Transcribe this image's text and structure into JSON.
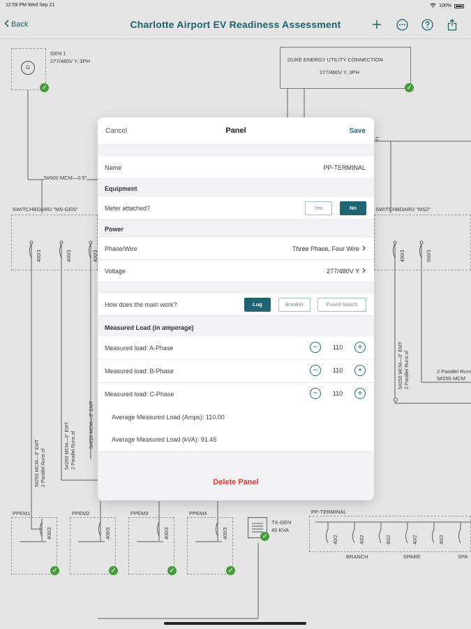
{
  "status_bar": {
    "time": "12:59 PM  Wed Sep 21",
    "battery": "100%"
  },
  "nav": {
    "back_label": "Back",
    "title": "Charlotte Airport EV Readiness Assessment"
  },
  "diagram": {
    "gen": {
      "name": "GEN 1",
      "spec": "277/480V Y, 3PH"
    },
    "utility": {
      "name": "DUKE ENERGY UTILITY CONNECTION",
      "spec": "277/480V Y, 3PH"
    },
    "feed_label": "5#500 MCM—0.5\"",
    "edge_label": "C",
    "swbd_gen": "SWITCHBOARD \"MS-GEN\"",
    "swbd_ms2": "SWITCHBOARD \"MS2\"",
    "left_breakers": [
      "400/3",
      "400/3",
      "400/3"
    ],
    "right_breakers": [
      "400/3",
      "500/3"
    ],
    "cable_a": "5#250 MCM—3\" EMT",
    "cable_a2": "2 Parallel Runs of",
    "cable_b": "5#250 MCM—3\" EMT",
    "cable_b2": "2 Parallel Runs of",
    "cable_c": "5#250 MCM—3\" EMT",
    "cable_d": "5#250 MCM—3\" EMT",
    "cable_d2": "2 Parallel Runs of",
    "right_runs_1": "2 Parallel Runs",
    "right_runs_2": "5#250 MCM",
    "ppem": [
      {
        "name": "PPEM1",
        "breaker": "400/3"
      },
      {
        "name": "PPEM2",
        "breaker": "400/3"
      },
      {
        "name": "PPEM3",
        "breaker": "400/3"
      },
      {
        "name": "PPEM4",
        "breaker": "400/3"
      }
    ],
    "tx": {
      "name": "TX-GEN",
      "spec": "45 KVA"
    },
    "pp_terminal": "PP-TERMINAL",
    "pp_breakers": [
      "40/2",
      "40/2",
      "40/2",
      "40/2",
      "40/2"
    ],
    "pp_labels": [
      "BRANCH",
      "SPARE",
      "SPA"
    ]
  },
  "modal": {
    "cancel_label": "Cancel",
    "title": "Panel",
    "save_label": "Save",
    "name_key": "Name",
    "name_value": "PP-TERMINAL",
    "equipment_header": "Equipment",
    "meter_key": "Meter attached?",
    "meter_yes": "Yes",
    "meter_no": "No",
    "power_header": "Power",
    "phase_key": "Phase/Wire",
    "phase_value": "Three Phase, Four Wire",
    "voltage_key": "Voltage",
    "voltage_value": "277/480V Y",
    "main_key": "How does the main work?",
    "main_options": [
      "Lug",
      "Breaker",
      "Fused Switch"
    ],
    "main_selected": "Lug",
    "measured_header": "Measured Load (in amperage)",
    "loads": [
      {
        "label": "Measured load: A-Phase",
        "value": "110"
      },
      {
        "label": "Measured load: B-Phase",
        "value": "110"
      },
      {
        "label": "Measured load: C-Phase",
        "value": "110"
      }
    ],
    "avg_amps": "Average Measured Load (Amps): 110.00",
    "avg_kva": "Average Measured Load (kVA): 91.45",
    "delete_label": "Delete Panel"
  }
}
